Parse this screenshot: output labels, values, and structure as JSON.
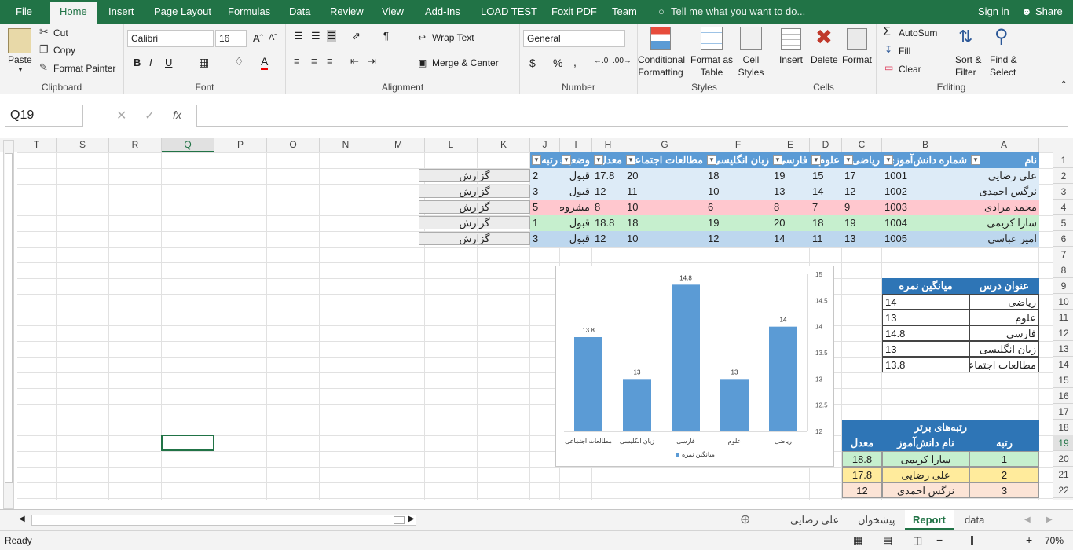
{
  "tabs": {
    "file": "File",
    "home": "Home",
    "insert": "Insert",
    "page_layout": "Page Layout",
    "formulas": "Formulas",
    "data": "Data",
    "review": "Review",
    "view": "View",
    "addins": "Add-Ins",
    "load_test": "LOAD TEST",
    "foxit": "Foxit PDF",
    "team": "Team",
    "tell_me": "Tell me what you want to do...",
    "sign_in": "Sign in",
    "share": "Share"
  },
  "ribbon": {
    "clipboard": {
      "paste": "Paste",
      "cut": "Cut",
      "copy": "Copy",
      "format_painter": "Format Painter",
      "label": "Clipboard"
    },
    "font": {
      "name": "Calibri",
      "size": "16",
      "label": "Font",
      "bold": "B",
      "italic": "I",
      "underline": "U"
    },
    "alignment": {
      "wrap": "Wrap Text",
      "merge": "Merge & Center",
      "label": "Alignment"
    },
    "number": {
      "format": "General",
      "currency": "$",
      "percent": "%",
      "comma": ",",
      "label": "Number"
    },
    "styles": {
      "conditional": "Conditional",
      "conditional2": "Formatting",
      "format_as": "Format as",
      "format_as2": "Table",
      "cell": "Cell",
      "cell2": "Styles",
      "label": "Styles"
    },
    "cells": {
      "insert": "Insert",
      "delete": "Delete",
      "format": "Format",
      "label": "Cells"
    },
    "editing": {
      "autosum": "AutoSum",
      "fill": "Fill",
      "clear": "Clear",
      "sort": "Sort &",
      "sort2": "Filter",
      "find": "Find &",
      "find2": "Select",
      "label": "Editing"
    }
  },
  "formula_bar": {
    "name_box": "Q19",
    "fx": "fx",
    "content": ""
  },
  "columns": [
    "T",
    "S",
    "R",
    "Q",
    "P",
    "O",
    "N",
    "M",
    "L",
    "K",
    "J",
    "I",
    "H",
    "G",
    "F",
    "E",
    "D",
    "C",
    "B",
    "A"
  ],
  "rows": [
    "1",
    "2",
    "3",
    "4",
    "5",
    "6",
    "7",
    "8",
    "9",
    "10",
    "11",
    "12",
    "13",
    "14",
    "15",
    "16",
    "17",
    "18",
    "19",
    "20",
    "21",
    "22"
  ],
  "table": {
    "headers": [
      "نام",
      "شماره دانش‌آموزی",
      "ریاضی",
      "علوم",
      "فارسی",
      "زبان انگلیسی",
      "مطالعات اجتماعی",
      "معدل",
      "وضعیت",
      "رتبه"
    ],
    "rows": [
      {
        "name": "علی رضایی",
        "id": "1001",
        "math": "17",
        "sci": "15",
        "fa": "19",
        "en": "18",
        "soc": "20",
        "avg": "17.8",
        "status": "قبول",
        "rank": "2"
      },
      {
        "name": "نرگس احمدی",
        "id": "1002",
        "math": "12",
        "sci": "14",
        "fa": "13",
        "en": "10",
        "soc": "11",
        "avg": "12",
        "status": "قبول",
        "rank": "3"
      },
      {
        "name": "محمد مرادی",
        "id": "1003",
        "math": "9",
        "sci": "7",
        "fa": "8",
        "en": "6",
        "soc": "10",
        "avg": "8",
        "status": "مشروط",
        "rank": "5"
      },
      {
        "name": "سارا کریمی",
        "id": "1004",
        "math": "19",
        "sci": "18",
        "fa": "20",
        "en": "19",
        "soc": "18",
        "avg": "18.8",
        "status": "قبول",
        "rank": "1"
      },
      {
        "name": "امیر عباسی",
        "id": "1005",
        "math": "13",
        "sci": "11",
        "fa": "14",
        "en": "12",
        "soc": "10",
        "avg": "12",
        "status": "قبول",
        "rank": "3"
      }
    ],
    "report_label": "گزارش"
  },
  "course_table": {
    "headers": [
      "عنوان درس",
      "میانگین نمره"
    ],
    "rows": [
      [
        "ریاضی",
        "14"
      ],
      [
        "علوم",
        "13"
      ],
      [
        "فارسی",
        "14.8"
      ],
      [
        "زبان انگلیسی",
        "13"
      ],
      [
        "مطالعات اجتماعی",
        "13.8"
      ]
    ]
  },
  "top_table": {
    "title": "رتبه‌های برتر",
    "headers": [
      "رتبه",
      "نام دانش‌آموز",
      "معدل"
    ],
    "rows": [
      [
        "1",
        "سارا کریمی",
        "18.8"
      ],
      [
        "2",
        "علی رضایی",
        "17.8"
      ],
      [
        "3",
        "نرگس احمدی",
        "12"
      ]
    ]
  },
  "chart_data": {
    "type": "bar",
    "categories": [
      "ریاضی",
      "علوم",
      "فارسی",
      "زبان انگلیسی",
      "مطالعات اجتماعی"
    ],
    "series": [
      {
        "name": "میانگین نمره",
        "values": [
          14,
          13,
          14.8,
          13,
          13.8
        ]
      }
    ],
    "ylim": [
      12,
      15
    ],
    "yticks": [
      "12",
      "12.5",
      "13",
      "13.5",
      "14",
      "14.5",
      "15"
    ],
    "axis_position": "right",
    "x_order": "right-to-left",
    "legend": "bottom",
    "color": "#5b9bd5"
  },
  "sheet_tabs": [
    "data",
    "Report",
    "پیشخوان",
    "علی رضایی"
  ],
  "status": {
    "ready": "Ready",
    "zoom": "70%"
  }
}
